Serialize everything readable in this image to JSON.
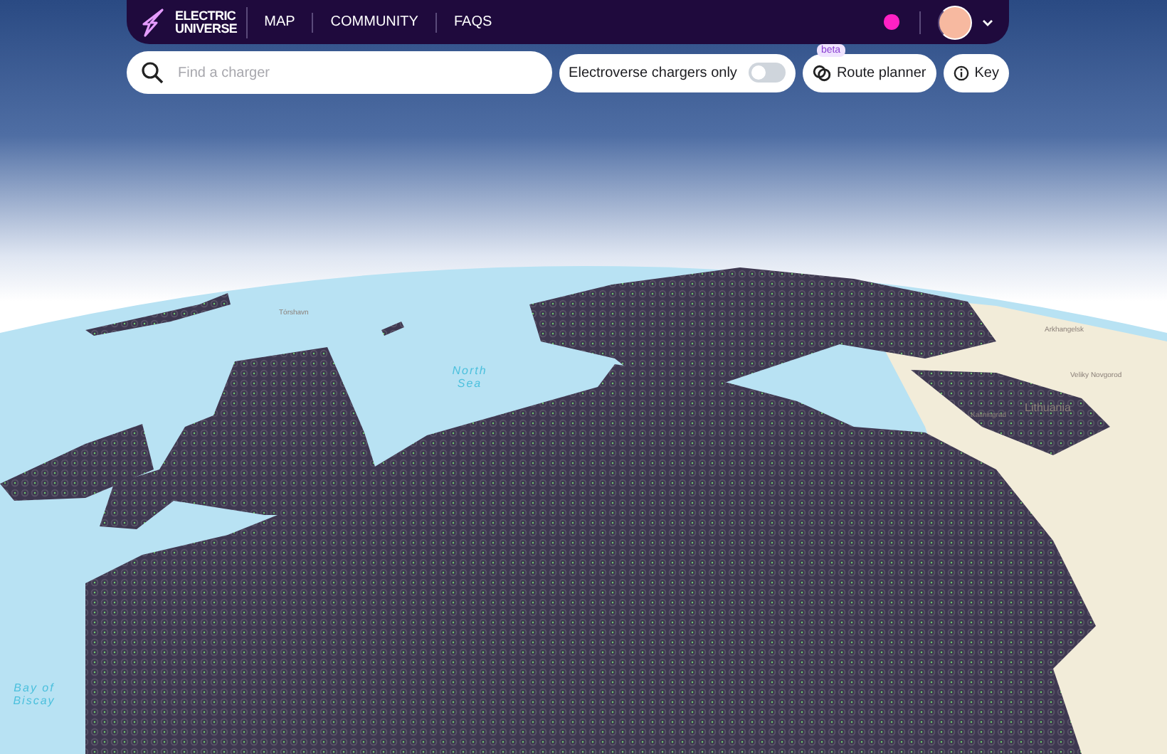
{
  "nav": {
    "logo_lines": [
      "ELECTRIC",
      "UNIVERSE"
    ],
    "links": [
      {
        "label": "MAP"
      },
      {
        "label": "COMMUNITY"
      },
      {
        "label": "FAQS"
      }
    ]
  },
  "search": {
    "placeholder": "Find a charger"
  },
  "filter_toggle": {
    "label": "Electroverse chargers only",
    "on": false
  },
  "route_planner": {
    "label": "Route planner",
    "badge": "beta"
  },
  "key_button": {
    "label": "Key"
  },
  "map": {
    "labels": [
      {
        "text": "Tórshavn",
        "kind": "city"
      },
      {
        "text": "North Sea",
        "kind": "sea"
      },
      {
        "text": "Arkhangelsk",
        "kind": "city"
      },
      {
        "text": "Veliky Novgorod",
        "kind": "city"
      },
      {
        "text": "Kaliningrad",
        "kind": "city"
      },
      {
        "text": "Lithuania",
        "kind": "country"
      },
      {
        "text": "Bay of Biscay",
        "kind": "sea"
      }
    ]
  }
}
